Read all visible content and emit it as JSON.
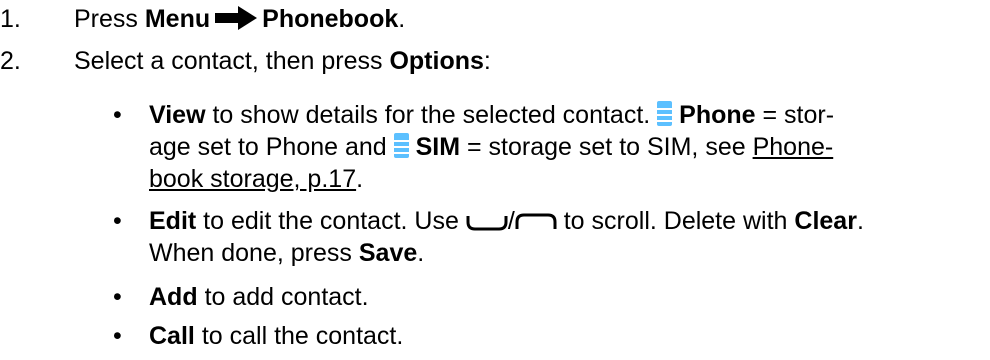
{
  "steps": [
    {
      "number": "1.",
      "press": "Press",
      "menu": "Menu",
      "phonebook": "Phonebook",
      "period": "."
    },
    {
      "number": "2.",
      "text": "Select a contact, then press",
      "options": "Options",
      "colon": ":"
    }
  ],
  "bullets": [
    {
      "marker": "•",
      "view": "View",
      "view_text": "to show details for the selected contact.",
      "phone": "Phone",
      "eq1": "= stor-",
      "line2_a": "age set to Phone and",
      "sim": "SIM",
      "line2_b": "= storage set to SIM, see",
      "link_a": "Phone-",
      "link_b": "book storage, p.17",
      "end": "."
    },
    {
      "marker": "•",
      "edit": "Edit",
      "edit_text": "to edit the contact. Use",
      "slash": "/",
      "scroll": "to scroll. Delete with",
      "clear": "Clear",
      "clear_end": ".",
      "line2": "When done, press",
      "save": "Save",
      "save_end": "."
    },
    {
      "marker": "•",
      "add": "Add",
      "add_text": "to add contact."
    },
    {
      "marker": "•",
      "call": "Call",
      "call_text": "to call the contact."
    }
  ],
  "icons": {
    "arrow": "right-arrow-icon",
    "storage": "storage-bars-icon",
    "down_key": "down-key-icon",
    "up_key": "up-key-icon"
  },
  "colors": {
    "storage_icon": "#5cc0ff",
    "text": "#000000"
  }
}
